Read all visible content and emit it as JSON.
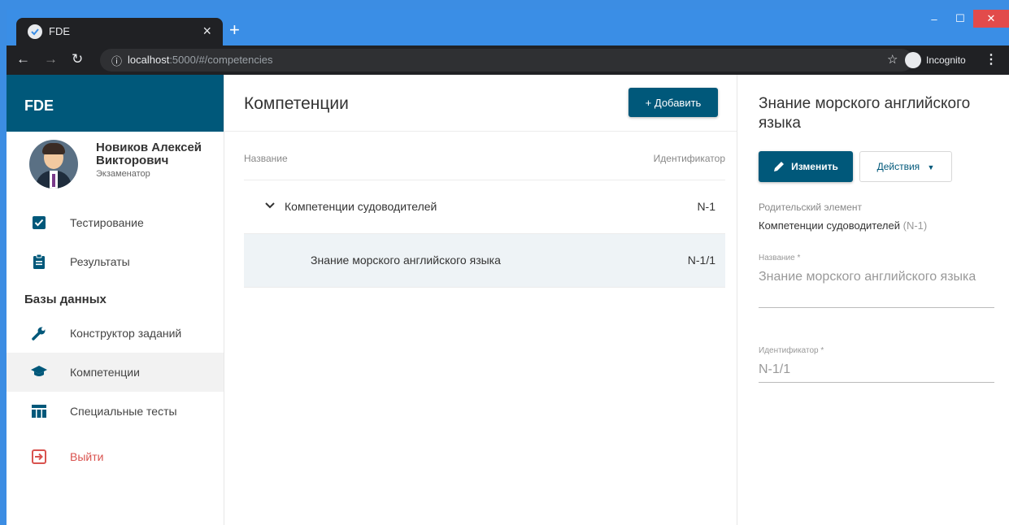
{
  "browser": {
    "tab_title": "FDE",
    "tab_close": "×",
    "new_tab": "+",
    "url_host": "localhost",
    "url_rest": ":5000/#/competencies",
    "incognito_label": "Incognito"
  },
  "sidebar": {
    "brand": "FDE",
    "user": {
      "name": "Новиков Алексей Викторович",
      "role": "Экзаменатор"
    },
    "items": [
      {
        "label": "Тестирование",
        "icon": "checkbox-icon"
      },
      {
        "label": "Результаты",
        "icon": "clipboard-icon"
      }
    ],
    "section_title": "Базы данных",
    "db_items": [
      {
        "label": "Конструктор заданий",
        "icon": "wrench-icon"
      },
      {
        "label": "Компетенции",
        "icon": "graduation-cap-icon",
        "active": true
      },
      {
        "label": "Специальные тесты",
        "icon": "table-icon"
      }
    ],
    "logout": {
      "label": "Выйти",
      "icon": "logout-icon"
    }
  },
  "main": {
    "title": "Компетенции",
    "add_button": "+ Добавить",
    "columns": {
      "name": "Название",
      "id": "Идентификатор"
    },
    "rows": [
      {
        "name": "Компетенции судоводителей",
        "id": "N-1",
        "expanded": true
      },
      {
        "name": "Знание морского английского языка",
        "id": "N-1/1",
        "selected": true
      }
    ]
  },
  "detail": {
    "title": "Знание морского английского языка",
    "edit_button": "Изменить",
    "actions_button": "Действия",
    "parent_label": "Родительский элемент",
    "parent_value": "Компетенции судоводителей",
    "parent_id": "(N-1)",
    "name_label": "Название *",
    "name_value": "Знание морского английского языка",
    "id_label": "Идентификатор *",
    "id_value": "N-1/1"
  },
  "colors": {
    "brand": "#00587a",
    "logout": "#d9534f",
    "accent_blue": "#2979c2"
  }
}
